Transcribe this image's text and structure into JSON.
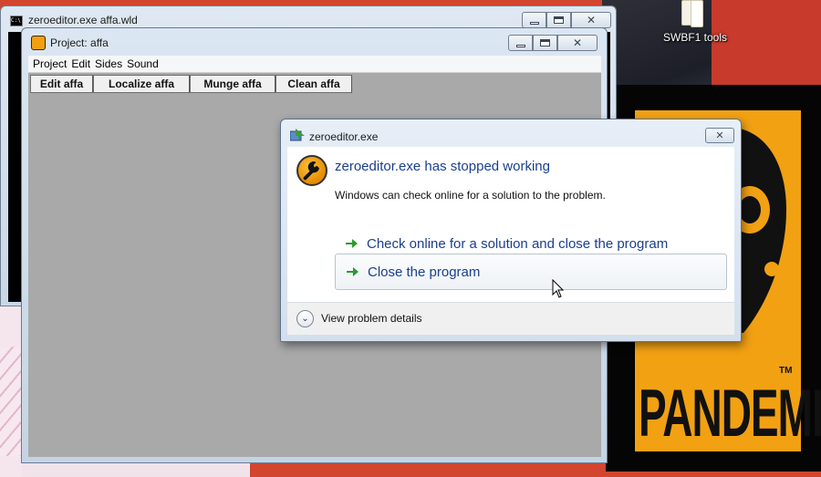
{
  "desktop": {
    "shortcut_label": "SWBF1 tools",
    "pandemic_word": "PANDEMIC",
    "pandemic_tm": "TM"
  },
  "console_window": {
    "title": "zeroeditor.exe  affa.wld",
    "icon": "console-icon"
  },
  "project_window": {
    "title": "Project: affa",
    "menu": [
      "Project",
      "Edit",
      "Sides",
      "Sound"
    ],
    "tabs": [
      "Edit affa",
      "Localize affa",
      "Munge affa",
      "Clean affa"
    ]
  },
  "error_dialog": {
    "title": "zeroeditor.exe",
    "heading": "zeroeditor.exe has stopped working",
    "description": "Windows can check online for a solution to the problem.",
    "options": [
      "Check online for a solution and close the program",
      "Close the program"
    ],
    "details_label": "View problem details",
    "close_glyph": "✕",
    "arrow_color": "#2a9b2a",
    "link_color": "#1a3f8f"
  }
}
